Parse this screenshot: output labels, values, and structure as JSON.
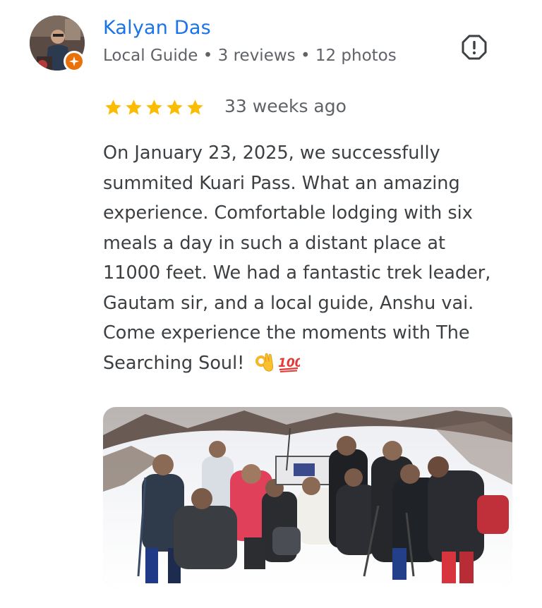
{
  "reviewer": {
    "name": "Kalyan Das",
    "meta": "Local Guide • 3 reviews • 12 photos",
    "avatar_icon": "profile-photo",
    "badge_icon": "local-guide-star-icon",
    "badge_color": "#e8710a"
  },
  "review": {
    "rating": 5,
    "rating_max": 5,
    "star_color": "#fbbc04",
    "time": "33 weeks ago",
    "text_lines": [
      "On January 23, 2025, we successfully",
      "summited Kuari Pass. What an amazing",
      "experience. Comfortable lodging with six",
      "meals a day in such a distant place at",
      "11000 feet. We had a fantastic trek leader,",
      "Gautam sir, and a local guide, Anshu vai.",
      "Come experience the moments with The",
      "Searching Soul!"
    ],
    "emojis": [
      "ok-hand-emoji",
      "hundred-points-emoji"
    ],
    "report_icon": "report-exclamation-icon"
  },
  "photo": {
    "description_icon": "group-trek-snow-photo"
  },
  "colors": {
    "name_link": "#1a73e8",
    "secondary_text": "#5f6368",
    "body_text": "#3c4043"
  }
}
